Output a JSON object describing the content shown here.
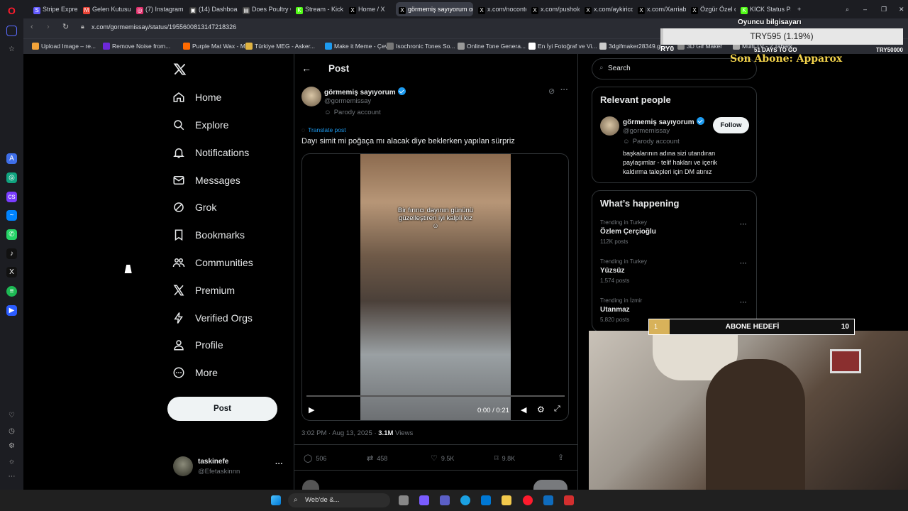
{
  "tabs": [
    {
      "label": "Stripe Express",
      "color": "#635bff",
      "glyph": "S"
    },
    {
      "label": "Gelen Kutusu (5",
      "color": "#ea4335",
      "glyph": "M"
    },
    {
      "label": "(7) Instagram",
      "color": "#e1306c",
      "glyph": "◎"
    },
    {
      "label": "(14) Dashboard",
      "color": "#3b3b3b",
      "glyph": "▣"
    },
    {
      "label": "Does Poultry C",
      "color": "#4a4a4a",
      "glyph": "▤"
    },
    {
      "label": "Stream - Kick D",
      "color": "#53fc18",
      "glyph": "K"
    },
    {
      "label": "Home / X",
      "color": "#000000",
      "glyph": "X"
    },
    {
      "label": "görmemiş sayıyorum on",
      "color": "#000000",
      "glyph": "X",
      "active": true
    },
    {
      "label": "x.com/noconte",
      "color": "#000000",
      "glyph": "X"
    },
    {
      "label": "x.com/pushold",
      "color": "#000000",
      "glyph": "X"
    },
    {
      "label": "x.com/aykirico",
      "color": "#000000",
      "glyph": "X"
    },
    {
      "label": "x.com/Xarriabl",
      "color": "#000000",
      "glyph": "X"
    },
    {
      "label": "Özgür Özel on",
      "color": "#000000",
      "glyph": "X"
    },
    {
      "label": "KICK Status Pag",
      "color": "#53fc18",
      "glyph": "K"
    }
  ],
  "address": {
    "url": "x.com/gormemissay/status/1955600813147218326"
  },
  "bookmarks": [
    {
      "label": "Upload Image – re...",
      "color": "#f2a33a"
    },
    {
      "label": "Remove Noise from...",
      "color": "#6d28d9"
    },
    {
      "label": "Purple Mat Wax - M...",
      "color": "#ff6a00"
    },
    {
      "label": "Türkiye MEG - Asker...",
      "color": "#e0b341"
    },
    {
      "label": "Make it Meme - Çev...",
      "color": "#1d9bf0"
    },
    {
      "label": "Isochronic Tones So...",
      "color": "#777777"
    },
    {
      "label": "Online Tone Genera...",
      "color": "#999999"
    },
    {
      "label": "En İyi Fotoğraf ve Vi...",
      "color": "#ffffff"
    },
    {
      "label": "3dgifmaker28349.gi...",
      "color": "#cccccc"
    },
    {
      "label": "3D Gif Maker",
      "color": "#888888"
    },
    {
      "label": "Multi TV - 2 Taberk...",
      "color": "#aaaaaa"
    }
  ],
  "nav": {
    "items": [
      "Home",
      "Explore",
      "Notifications",
      "Messages",
      "Grok",
      "Bookmarks",
      "Communities",
      "Premium",
      "Verified Orgs",
      "Profile",
      "More"
    ],
    "post_label": "Post",
    "account_name": "taskinefe",
    "account_handle": "@Efetaskinnn"
  },
  "post": {
    "header": "Post",
    "author_name": "görmemiş sayıyorum",
    "author_handle": "@gormemissay",
    "parody_label": "Parody account",
    "translate_label": "Translate post",
    "text": "Dayı simit mi poğaça mı alacak diye beklerken yapılan sürpriz",
    "video_caption_line1": "Bir fırıncı dayının gününü",
    "video_caption_line2": "güzelleştiren iyi kalpli kız",
    "video_time": "0:00 / 0:21",
    "progress": 0,
    "timestamp": "3:02 PM · Aug 13, 2025 · ",
    "views": "3.1M",
    "views_label": " Views",
    "replies": "506",
    "reposts": "458",
    "likes": "9.5K",
    "bookmarks": "9.8K"
  },
  "search": {
    "placeholder": "Search"
  },
  "relevant": {
    "title": "Relevant people",
    "name": "görmemiş sayıyorum",
    "handle": "@gormemissay",
    "follow_label": "Follow",
    "parody_label": "Parody account",
    "bio": "başkalarının adına sizi utandıran paylaşımlar - telif hakları ve içerik kaldırma talepleri için DM atınız"
  },
  "happening": {
    "title": "What’s happening",
    "trends": [
      {
        "context": "Trending in Turkey",
        "name": "Özlem Çerçioğlu",
        "posts": "112K posts"
      },
      {
        "context": "Trending in Turkey",
        "name": "Yüzsüz",
        "posts": "1,574 posts"
      },
      {
        "context": "Trending in İzmir",
        "name": "Utanmaz",
        "posts": "5,820 posts"
      }
    ]
  },
  "overlay": {
    "goal_title": "Oyuncu bilgisayarı",
    "goal_amount": "TRY595 (1.19%)",
    "goal_left": "RY0",
    "goal_days": "51 DAYS TO GO",
    "goal_right": "TRY50000",
    "goal_progress": 0.0119,
    "last_sub": "Son Abone: Apparox",
    "sub_goal_label": "ABONE HEDEFİ",
    "sub_goal_current": "1",
    "sub_goal_target": "10",
    "sub_goal_progress": 0.1
  },
  "taskbar": {
    "search_label": "Web'de &..."
  }
}
